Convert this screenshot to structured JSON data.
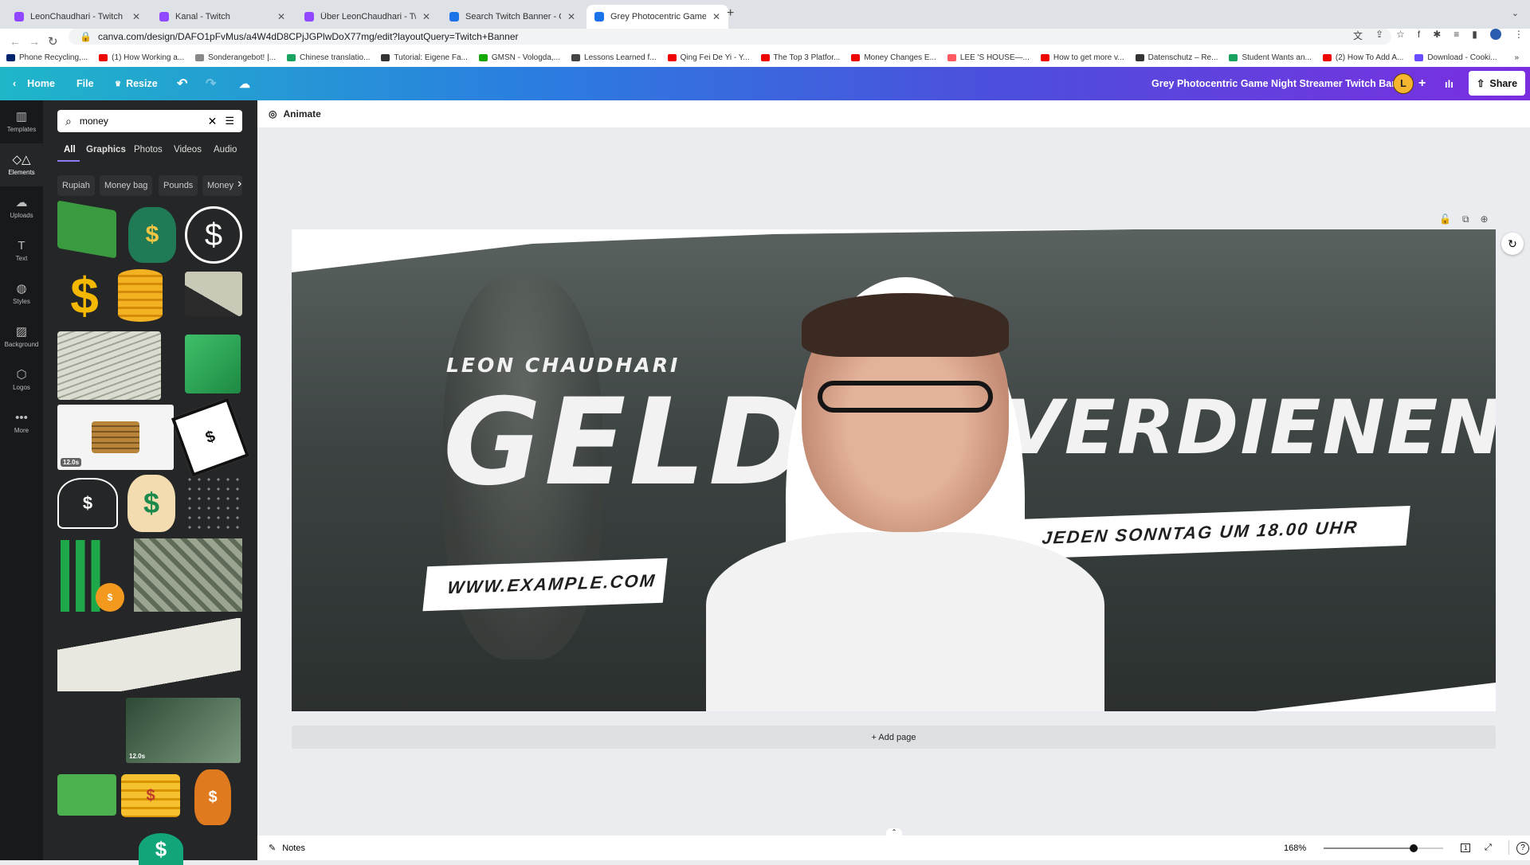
{
  "browser": {
    "tabs": [
      {
        "title": "LeonChaudhari - Twitch",
        "icon": "twitch-icon",
        "color": "#9146ff"
      },
      {
        "title": "Kanal - Twitch",
        "icon": "twitch-icon",
        "color": "#9146ff"
      },
      {
        "title": "Über LeonChaudhari - Twitch",
        "icon": "twitch-icon",
        "color": "#9146ff"
      },
      {
        "title": "Search Twitch Banner - Canva",
        "icon": "canva-icon",
        "color": "#1a73e8"
      },
      {
        "title": "Grey Photocentric Game Night Streamer Twitch Banner",
        "icon": "canva-icon",
        "color": "#1a73e8",
        "active": true
      }
    ],
    "url": "canva.com/design/DAFO1pFvMus/a4W4dD8CPjJGPlwDoX77mg/edit?layoutQuery=Twitch+Banner",
    "bookmarks": [
      {
        "label": "Phone Recycling,...",
        "color": "#00246b"
      },
      {
        "label": "(1) How Working a...",
        "color": "#e00"
      },
      {
        "label": "Sonderangebot! |...",
        "color": "#888"
      },
      {
        "label": "Chinese translatio...",
        "color": "#1aa260"
      },
      {
        "label": "Tutorial: Eigene Fa...",
        "color": "#333"
      },
      {
        "label": "GMSN - Vologda,...",
        "color": "#14a800"
      },
      {
        "label": "Lessons Learned f...",
        "color": "#444"
      },
      {
        "label": "Qing Fei De Yi - Y...",
        "color": "#e00"
      },
      {
        "label": "The Top 3 Platfor...",
        "color": "#e00"
      },
      {
        "label": "Money Changes E...",
        "color": "#e00"
      },
      {
        "label": "LEE 'S HOUSE—...",
        "color": "#ff5a5f"
      },
      {
        "label": "How to get more v...",
        "color": "#e00"
      },
      {
        "label": "Datenschutz – Re...",
        "color": "#333"
      },
      {
        "label": "Student Wants an...",
        "color": "#1aa260"
      },
      {
        "label": "(2) How To Add A...",
        "color": "#e00"
      },
      {
        "label": "Download - Cooki...",
        "color": "#6a4cff"
      }
    ]
  },
  "header": {
    "home": "Home",
    "file": "File",
    "resize": "Resize",
    "design_title": "Grey Photocentric Game Night Streamer Twitch Banner",
    "avatar_letter": "L",
    "share": "Share"
  },
  "rail": [
    {
      "label": "Templates",
      "icon": "templates-icon"
    },
    {
      "label": "Elements",
      "icon": "elements-icon",
      "active": true
    },
    {
      "label": "Uploads",
      "icon": "uploads-icon"
    },
    {
      "label": "Text",
      "icon": "text-icon"
    },
    {
      "label": "Styles",
      "icon": "styles-icon"
    },
    {
      "label": "Background",
      "icon": "background-icon"
    },
    {
      "label": "Logos",
      "icon": "logos-icon"
    },
    {
      "label": "More",
      "icon": "more-icon"
    }
  ],
  "panel": {
    "search_value": "money",
    "tabs": [
      "All",
      "Graphics",
      "Photos",
      "Videos",
      "Audio"
    ],
    "active_tab": "All",
    "chips": [
      "Rupiah",
      "Money bag",
      "Pounds",
      "Money"
    ],
    "video_durations": [
      "12.0s",
      "12.0s"
    ]
  },
  "editor": {
    "animate": "Animate",
    "add_page": "+ Add page",
    "notes": "Notes",
    "zoom": "168%",
    "zoom_value": 168,
    "page_number": "1"
  },
  "banner": {
    "name": "LEON CHAUDHARI",
    "word1": "GELD",
    "word2": "VERDIENEN",
    "schedule": "JEDEN SONNTAG UM 18.00 UHR",
    "website": "WWW.EXAMPLE.COM"
  },
  "colors": {
    "accent": "#8b3dff",
    "avatar": "#f5b52e"
  }
}
